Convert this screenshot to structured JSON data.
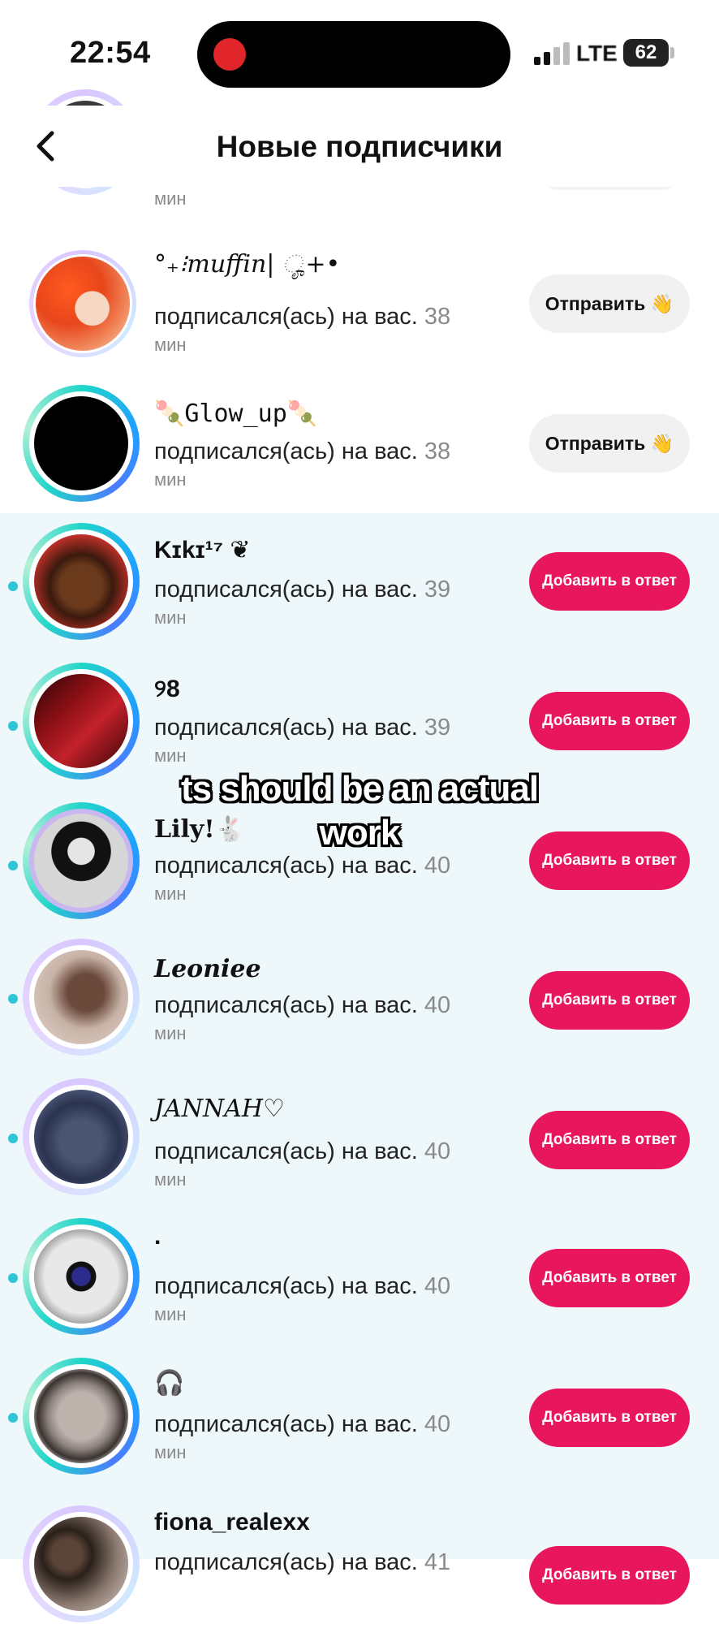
{
  "status": {
    "time": "22:54",
    "network": "LTE",
    "battery": "62"
  },
  "header": {
    "title": "Новые подписчики"
  },
  "top_partial": {
    "mins": "мин"
  },
  "subtitle_prefix": "подписался(ась) на вас.",
  "mins_label": "мин",
  "rows": [
    {
      "name": "°₊⁝muffin| ೄ+•",
      "ago": "38",
      "button": "Отправить 👋",
      "type": "send"
    },
    {
      "name": "🍡Glow_up🍡",
      "ago": "38",
      "button": "Отправить 👋",
      "type": "send"
    },
    {
      "name": "Kɪkɪ¹⁷ ❦",
      "ago": "39",
      "button": "Добавить в ответ",
      "type": "add"
    },
    {
      "name": "୨8",
      "ago": "39",
      "button": "Добавить в ответ",
      "type": "add"
    },
    {
      "name": "Lily!🐇",
      "ago": "40",
      "button": "Добавить в ответ",
      "type": "add"
    },
    {
      "name": "Leoniee",
      "ago": "40",
      "button": "Добавить в ответ",
      "type": "add"
    },
    {
      "name": "JANNAH♡",
      "ago": "40",
      "button": "Добавить в ответ",
      "type": "add"
    },
    {
      "name": ".",
      "ago": "40",
      "button": "Добавить в ответ",
      "type": "add"
    },
    {
      "name": "🎧",
      "ago": "40",
      "button": "Добавить в ответ",
      "type": "add"
    },
    {
      "name": "fiona_realexx",
      "ago": "41",
      "button": "Добавить в ответ",
      "type": "add"
    }
  ],
  "overlay": {
    "line1": "ts should be an actual",
    "line2": "work"
  }
}
